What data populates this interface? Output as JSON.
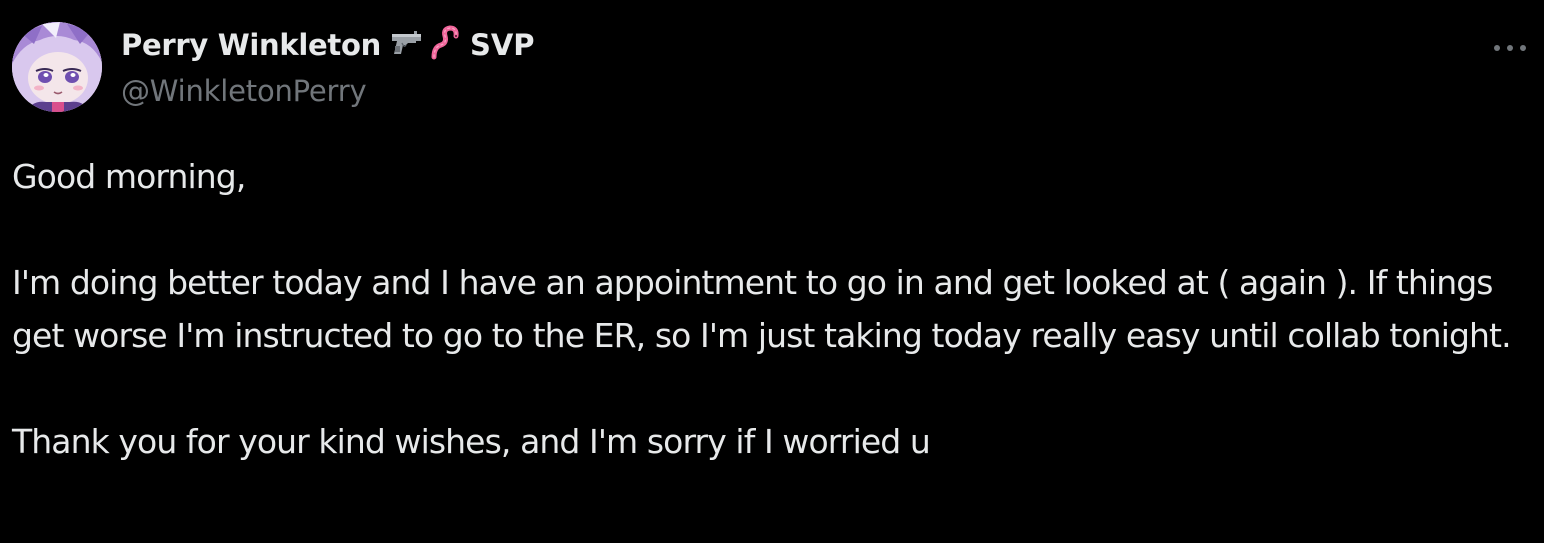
{
  "tweet": {
    "author": {
      "display_name": "Perry Winkleton",
      "emoji": [
        "pistol-emoji",
        "worm-emoji"
      ],
      "name_suffix": "SVP",
      "handle": "@WinkletonPerry",
      "avatar_icon": "avatar-anime-girl"
    },
    "more_icon": "more-icon",
    "body": {
      "greeting": "Good morning,",
      "paragraph_1": "I'm doing better today and I have an appointment to go in and get looked at ( again ). If things get worse I'm instructed to go to the ER, so I'm just taking today really easy until collab tonight.",
      "paragraph_2": "Thank you for your kind wishes, and I'm sorry if I worried u"
    }
  },
  "colors": {
    "background": "#000000",
    "text": "#e7e9ea",
    "secondary_text": "#71767b",
    "worm_emoji": "#f0669b"
  }
}
